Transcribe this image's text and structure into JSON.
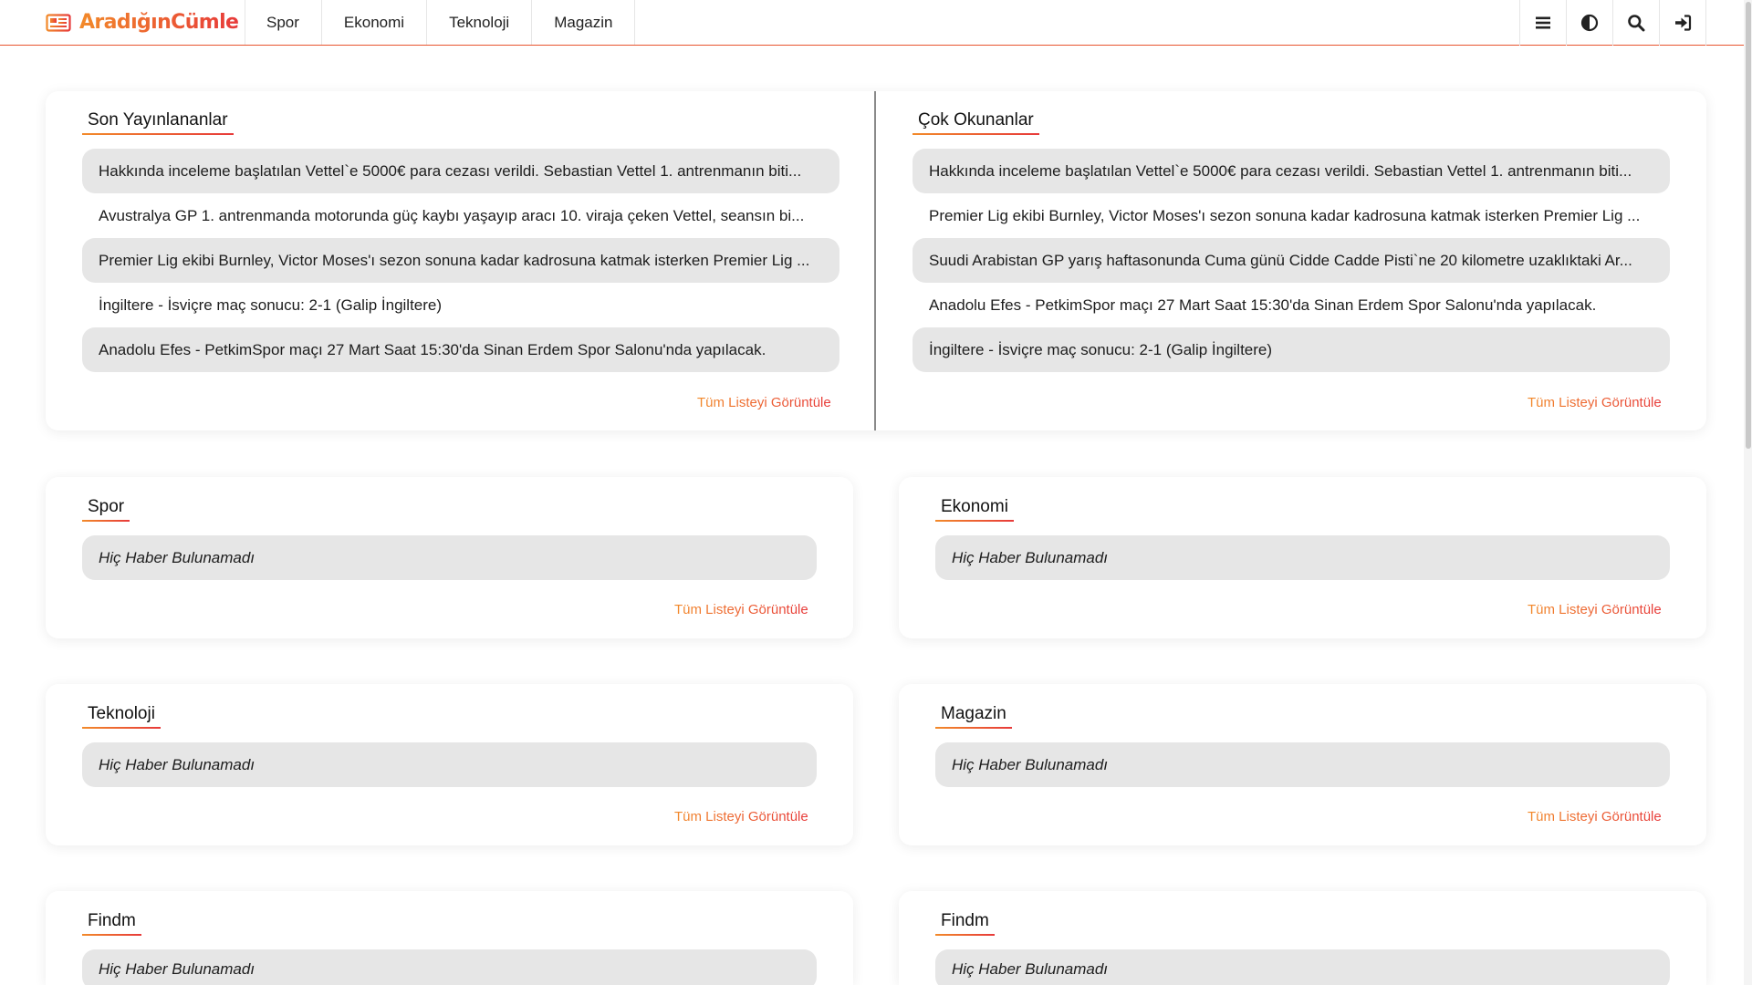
{
  "header": {
    "logo_text": "AradığınCümle",
    "nav": [
      "Spor",
      "Ekonomi",
      "Teknoloji",
      "Magazin"
    ],
    "tool_icons": [
      "menu-icon",
      "contrast-icon",
      "search-icon",
      "sign-in-icon"
    ]
  },
  "colors": {
    "accent_start": "#f28a2a",
    "accent_end": "#e73a3a",
    "row_shade": "#e6e6e6"
  },
  "latest": {
    "title": "Son Yayınlananlar",
    "items": [
      "Hakkında inceleme başlatılan Vettel`e 5000€ para cezası verildi. Sebastian Vettel 1. antrenmanın biti...",
      "Avustralya GP 1. antrenmanda motorunda güç kaybı yaşayıp aracı 10. viraja çeken Vettel, seansın bi...",
      "Premier Lig ekibi Burnley, Victor Moses'ı sezon sonuna kadar kadrosuna katmak isterken Premier Lig ...",
      "İngiltere - İsviçre maç sonucu: 2-1 (Galip İngiltere)",
      "Anadolu Efes - PetkimSpor maçı 27 Mart Saat 15:30'da Sinan Erdem Spor Salonu'nda yapılacak."
    ],
    "view_all": "Tüm Listeyi Görüntüle"
  },
  "popular": {
    "title": "Çok Okunanlar",
    "items": [
      "Hakkında inceleme başlatılan Vettel`e 5000€ para cezası verildi. Sebastian Vettel 1. antrenmanın biti...",
      "Premier Lig ekibi Burnley, Victor Moses'ı sezon sonuna kadar kadrosuna katmak isterken Premier Lig ...",
      "Suudi Arabistan GP yarış haftasonunda Cuma günü Cidde Cadde Pisti`ne 20 kilometre uzaklıktaki Ar...",
      "Anadolu Efes - PetkimSpor maçı 27 Mart Saat 15:30'da Sinan Erdem Spor Salonu'nda yapılacak.",
      "İngiltere - İsviçre maç sonucu: 2-1 (Galip İngiltere)"
    ],
    "view_all": "Tüm Listeyi Görüntüle"
  },
  "categories": [
    {
      "title": "Spor",
      "empty": "Hiç Haber Bulunamadı",
      "view_all": "Tüm Listeyi Görüntüle"
    },
    {
      "title": "Ekonomi",
      "empty": "Hiç Haber Bulunamadı",
      "view_all": "Tüm Listeyi Görüntüle"
    },
    {
      "title": "Teknoloji",
      "empty": "Hiç Haber Bulunamadı",
      "view_all": "Tüm Listeyi Görüntüle"
    },
    {
      "title": "Magazin",
      "empty": "Hiç Haber Bulunamadı",
      "view_all": "Tüm Listeyi Görüntüle"
    },
    {
      "title": "Findm",
      "empty": "Hiç Haber Bulunamadı",
      "view_all": ""
    },
    {
      "title": "Findm",
      "empty": "Hiç Haber Bulunamadı",
      "view_all": ""
    }
  ]
}
